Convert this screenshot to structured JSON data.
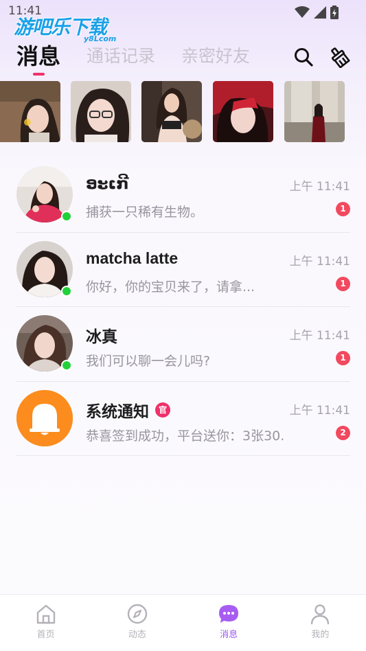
{
  "status_bar": {
    "time": "11:41"
  },
  "watermark": {
    "title": "游吧乐下载",
    "subtitle": "y8Lcom"
  },
  "tabs": [
    {
      "label": "消息",
      "active": true
    },
    {
      "label": "通话记录",
      "active": false
    },
    {
      "label": "亲密好友",
      "active": false
    }
  ],
  "header_actions": {
    "search_icon": "search-icon",
    "clear_icon": "broom-icon"
  },
  "photos": [
    {
      "name": "photo-1"
    },
    {
      "name": "photo-2"
    },
    {
      "name": "photo-3"
    },
    {
      "name": "photo-4"
    },
    {
      "name": "photo-5"
    }
  ],
  "conversations": [
    {
      "name": "ອະເກີ",
      "time": "上午 11:41",
      "preview": "捕获一只稀有生物。",
      "unread": "1",
      "online": true
    },
    {
      "name": "matcha latte",
      "time": "上午 11:41",
      "preview": "你好，你的宝贝来了，请拿...",
      "unread": "1",
      "online": true
    },
    {
      "name": "冰真",
      "time": "上午 11:41",
      "preview": "我们可以聊一会儿吗?",
      "unread": "1",
      "online": true
    },
    {
      "name": "系统通知",
      "badge": "官",
      "time": "上午 11:41",
      "preview": "恭喜签到成功，平台送你：3张30...",
      "unread": "2",
      "online": false
    }
  ],
  "bottom_nav": [
    {
      "label": "首页",
      "icon": "home-icon",
      "active": false
    },
    {
      "label": "动态",
      "icon": "compass-icon",
      "active": false
    },
    {
      "label": "消息",
      "icon": "chat-bubble-icon",
      "active": true
    },
    {
      "label": "我的",
      "icon": "person-icon",
      "active": false
    }
  ],
  "colors": {
    "accent_pink": "#f0306a",
    "unread_red": "#f2495f",
    "online_green": "#22d13a",
    "nav_active_purple": "#9b57f0",
    "notice_orange": "#fb8c1d"
  }
}
